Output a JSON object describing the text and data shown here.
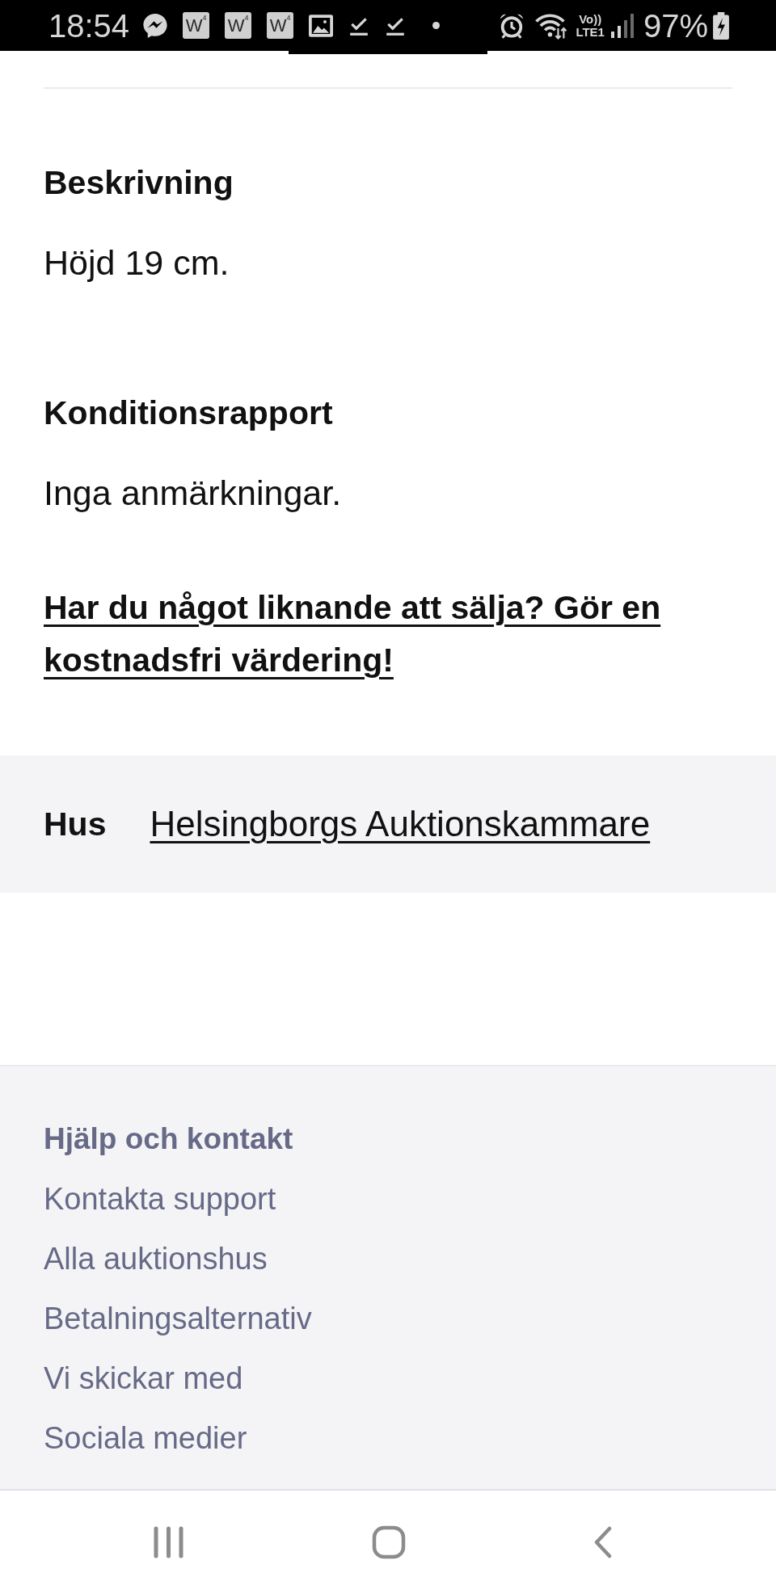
{
  "status_bar": {
    "time": "18:54",
    "notifications": [
      {
        "kind": "messenger"
      },
      {
        "kind": "tile",
        "letter": "W",
        "superscript": "4"
      },
      {
        "kind": "tile",
        "letter": "W",
        "superscript": "4"
      },
      {
        "kind": "tile",
        "letter": "W",
        "superscript": "4"
      },
      {
        "kind": "image"
      },
      {
        "kind": "download-done"
      },
      {
        "kind": "download-done"
      },
      {
        "kind": "dot"
      }
    ],
    "network": {
      "top": "Vo))",
      "bottom": "LTE1"
    },
    "battery": "97%"
  },
  "details": [
    {
      "heading": "Beskrivning",
      "text": "Höjd 19 cm."
    },
    {
      "heading": "Konditionsrapport",
      "text": "Inga anmärkningar."
    }
  ],
  "valuation_link": "Har du något liknande att sälja? Gör en kostnadsfri värdering!",
  "house": {
    "label": "Hus",
    "link": "Helsingborgs Auktionskammare"
  },
  "footer": {
    "heading": "Hjälp och kontakt",
    "links": [
      "Kontakta support",
      "Alla auktionshus",
      "Betalningsalternativ",
      "Vi skickar med",
      "Sociala medier"
    ]
  }
}
